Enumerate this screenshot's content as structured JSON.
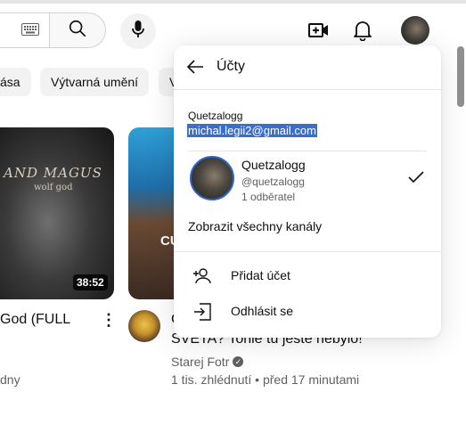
{
  "header": {
    "keyboard_icon": "keyboard-icon",
    "search_icon": "search-icon",
    "mic_icon": "microphone-icon",
    "create_icon": "video-create-icon",
    "bell_icon": "bell-icon"
  },
  "chips": [
    "ása",
    "Výtvarná umění",
    "V"
  ],
  "videos": [
    {
      "thumb_text": "AND MAGUS",
      "thumb_subtext": "wolf god",
      "duration": "38:52",
      "title": "God (FULL",
      "meta": "dny"
    },
    {
      "title_partial": "C",
      "thumb_text": "CU",
      "title": "SVĚTA? Tohle tu ještě nebylo!",
      "channel": "Starej Fotr",
      "stats": "1 tis. zhlédnutí • před 17 minutami"
    }
  ],
  "account_menu": {
    "title": "Účty",
    "account_name": "Quetzalogg",
    "email": "michal.legii2@gmail.com",
    "channel": {
      "name": "Quetzalogg",
      "handle": "@quetzalogg",
      "subscribers": "1 odběratel"
    },
    "show_all": "Zobrazit všechny kanály",
    "items": [
      {
        "label": "Přidat účet",
        "icon": "add-person-icon"
      },
      {
        "label": "Odhlásit se",
        "icon": "sign-out-icon"
      }
    ]
  }
}
